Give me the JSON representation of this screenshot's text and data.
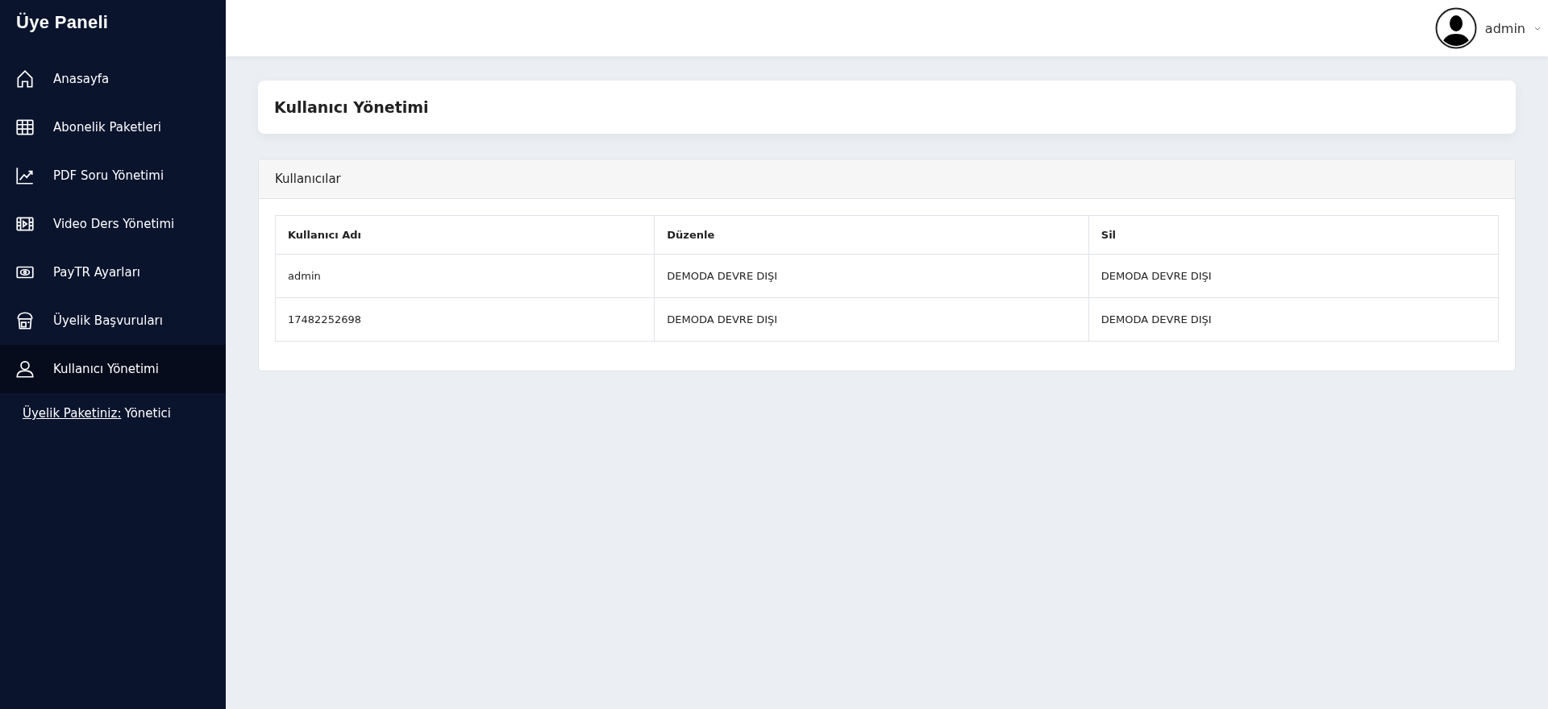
{
  "sidebar": {
    "title": "Üye Paneli",
    "items": [
      {
        "label": "Anasayfa",
        "selected": false
      },
      {
        "label": "Abonelik Paketleri",
        "selected": false
      },
      {
        "label": "PDF Soru Yönetimi",
        "selected": false
      },
      {
        "label": "Video Ders Yönetimi",
        "selected": false
      },
      {
        "label": "PayTR Ayarları",
        "selected": false
      },
      {
        "label": "Üyelik Başvuruları",
        "selected": false
      },
      {
        "label": "Kullanıcı Yönetimi",
        "selected": true
      }
    ],
    "membership": {
      "label": "Üyelik Paketiniz:",
      "value": "Yönetici"
    }
  },
  "header": {
    "user": "admin"
  },
  "page_title": "Kullanıcı Yönetimi",
  "users_card": {
    "title": "Kullanıcılar",
    "columns": [
      "Kullanıcı Adı",
      "Düzenle",
      "Sil"
    ],
    "rows": [
      [
        "admin",
        "DEMODA DEVRE DIŞI",
        "DEMODA DEVRE DIŞI"
      ],
      [
        "17482252698",
        "DEMODA DEVRE DIŞI",
        "DEMODA DEVRE DIŞI"
      ]
    ]
  }
}
